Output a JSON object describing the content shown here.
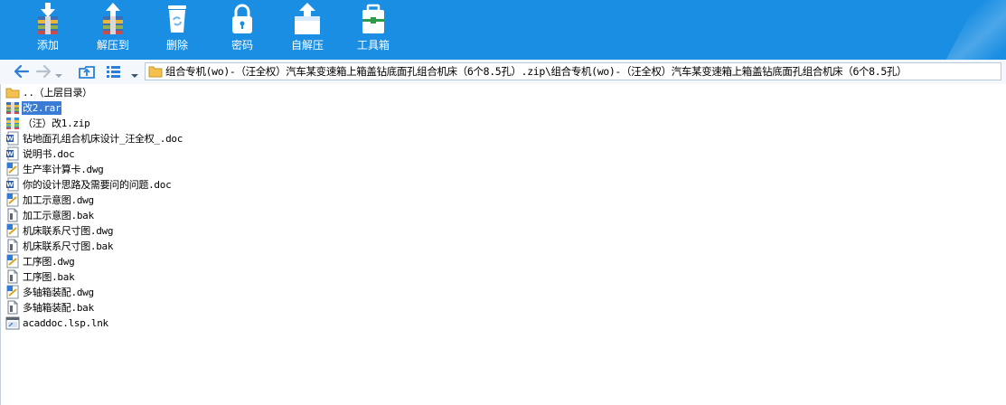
{
  "toolbar": {
    "buttons": [
      {
        "label": "添加",
        "icon": "add-archive-icon"
      },
      {
        "label": "解压到",
        "icon": "extract-to-icon"
      },
      {
        "label": "删除",
        "icon": "delete-icon"
      },
      {
        "label": "密码",
        "icon": "password-lock-icon"
      },
      {
        "label": "自解压",
        "icon": "self-extract-icon"
      },
      {
        "label": "工具箱",
        "icon": "toolbox-icon"
      }
    ]
  },
  "navbar": {
    "address": "组合专机(wo)-（汪全权）汽车某变速箱上箱盖钻底面孔组合机床（6个8.5孔）.zip\\组合专机(wo)-（汪全权）汽车某变速箱上箱盖钻底面孔组合机床（6个8.5孔）"
  },
  "files": [
    {
      "name": "..（上层目录）",
      "type": "parent-folder",
      "selected": false
    },
    {
      "name": "改2.rar",
      "type": "rar-archive",
      "selected": true
    },
    {
      "name": "（汪）改1.zip",
      "type": "zip-archive",
      "selected": false
    },
    {
      "name": "钻地面孔组合机床设计_汪全权_.doc",
      "type": "word-doc",
      "selected": false
    },
    {
      "name": "说明书.doc",
      "type": "word-doc",
      "selected": false
    },
    {
      "name": "生产率计算卡.dwg",
      "type": "dwg-drawing",
      "selected": false
    },
    {
      "name": "你的设计思路及需要问的问题.doc",
      "type": "word-doc",
      "selected": false
    },
    {
      "name": "加工示意图.dwg",
      "type": "dwg-drawing",
      "selected": false
    },
    {
      "name": "加工示意图.bak",
      "type": "bak-file",
      "selected": false
    },
    {
      "name": "机床联系尺寸图.dwg",
      "type": "dwg-drawing",
      "selected": false
    },
    {
      "name": "机床联系尺寸图.bak",
      "type": "bak-file",
      "selected": false
    },
    {
      "name": "工序图.dwg",
      "type": "dwg-drawing",
      "selected": false
    },
    {
      "name": "工序图.bak",
      "type": "bak-file",
      "selected": false
    },
    {
      "name": "多轴箱装配.dwg",
      "type": "dwg-drawing",
      "selected": false
    },
    {
      "name": "多轴箱装配.bak",
      "type": "bak-file",
      "selected": false
    },
    {
      "name": "acaddoc.lsp.lnk",
      "type": "shortcut-file",
      "selected": false
    }
  ]
}
